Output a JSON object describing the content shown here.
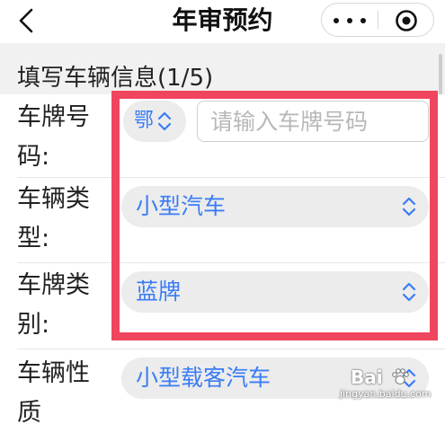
{
  "nav": {
    "title": "年审预约",
    "back_icon": "chevron-left-icon",
    "more_icon": "more-dots-icon",
    "close_icon": "target-circle-icon"
  },
  "section": {
    "title": "填写车辆信息(1/5)"
  },
  "form": {
    "plate_number": {
      "label": "车牌号码:",
      "prefix_value": "鄂",
      "placeholder": "请输入车牌号码",
      "value": ""
    },
    "vehicle_type": {
      "label": "车辆类型:",
      "value": "小型汽车"
    },
    "plate_type": {
      "label": "车牌类别:",
      "value": "蓝牌"
    },
    "vehicle_nature": {
      "label": "车辆性质",
      "value": "小型载客汽车"
    }
  },
  "watermark": {
    "text": "Bai",
    "sub": "jingyan.baidu.com"
  },
  "colors": {
    "accent": "#3a7cf5",
    "highlight": "#f0455e",
    "pill_bg": "#ececec",
    "page_bg": "#f1f1f1"
  }
}
